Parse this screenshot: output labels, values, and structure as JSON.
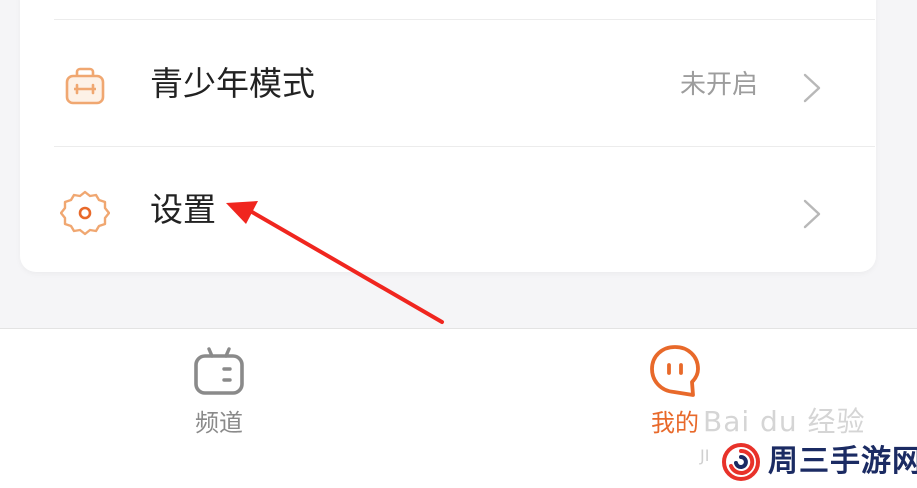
{
  "menu": {
    "youth_mode": {
      "label": "青少年模式",
      "value": "未开启",
      "icon": "briefcase-icon"
    },
    "settings": {
      "label": "设置",
      "icon": "gear-icon"
    }
  },
  "tabbar": {
    "channels": {
      "label": "频道",
      "icon": "tv-icon"
    },
    "mine": {
      "label": "我的",
      "icon": "chat-face-icon",
      "active": true
    }
  },
  "colors": {
    "accent": "#e8692a",
    "icon_orange": "#f0a771",
    "inactive": "#8a8a8a",
    "annotation_red": "#f0261f"
  },
  "watermark": {
    "baidu": "Bai du 经验",
    "site": "周三手游网"
  }
}
